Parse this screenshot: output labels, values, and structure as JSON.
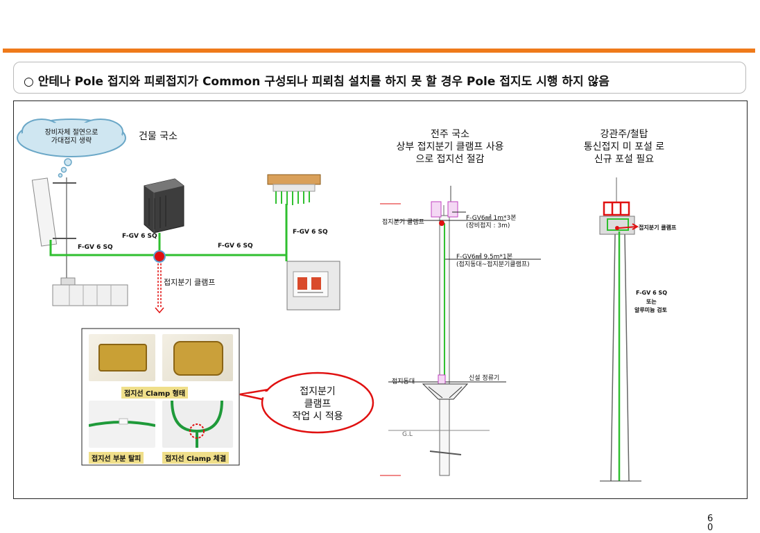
{
  "title": "○ 안테나 Pole 접지와 피뢰접지가 Common 구성되나 피뢰침 설치를 하지 못 할 경우 Pole 접지도 시행 하지 않음",
  "page_number": "60",
  "building": {
    "section_title": "건물 국소",
    "cloud_text": "장비자체 절연으로\n가대접지 생략",
    "wire_label_left": "F-GV  6 SQ",
    "wire_label_device": "F-GV  6 SQ",
    "wire_label_mid": "F-GV  6 SQ",
    "wire_label_right": "F-GV  6 SQ",
    "clamp_label": "접지분기 클램프"
  },
  "inset": {
    "caption_shape": "접지선 Clamp 형태",
    "caption_strip": "접지선 부분 탈피",
    "caption_fasten": "접지선 Clamp 체결"
  },
  "callout": "접지분기\n클램프\n작업 시 적용",
  "pole": {
    "section_title": "전주 국소\n상부 접지분기 클램프 사용\n으로 접지선 절감",
    "clamp_label": "접지분기 클램프",
    "wire_top_label": "F-GV6㎟ 1m*3본",
    "wire_top_sub": "(장비접지 : 3m)",
    "wire_mid_label": "F-GV6㎟ 9.5m*1본",
    "wire_mid_sub": "(접지동대~접지분기클램프)",
    "ground_bar_label": "접지동대",
    "arrester_label": "신설 정류기",
    "gl_label": "G.L"
  },
  "tower": {
    "section_title": "강관주/철탑\n통신접지 미 포설 로\n신규 포설 필요",
    "clamp_label": "접지분기 클램프",
    "wire_label": "F-GV  6 SQ",
    "wire_or": "또는",
    "wire_alt": "알루미늄 검토"
  },
  "colors": {
    "accent_orange": "#ef7a1a",
    "ground_wire_green": "#2fbf2f",
    "alert_red": "#e01010"
  }
}
